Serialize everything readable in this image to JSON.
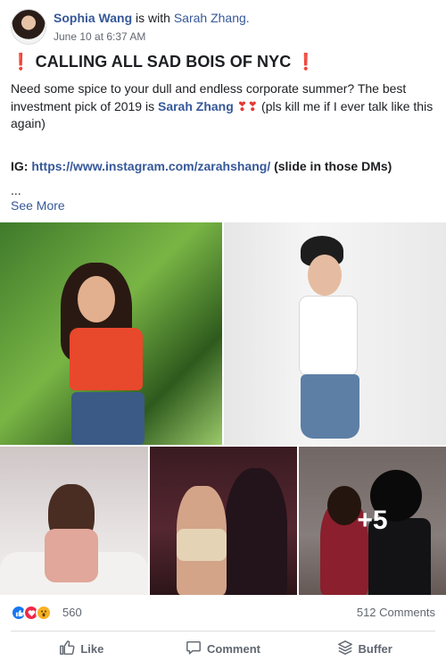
{
  "post": {
    "author": "Sophia Wang",
    "with_text": "is with",
    "tagged": "Sarah Zhang.",
    "timestamp": "June 10 at 6:37 AM",
    "title": "CALLING ALL SAD BOIS OF NYC",
    "title_emoji": "❗",
    "body_part1": "Need some spice to your dull and endless corporate summer? The best investment pick of 2019 is",
    "mention": "Sarah Zhang",
    "hearts": "❣❣",
    "body_part2": "(pls kill me if I ever talk like this again)",
    "ig_prefix": "IG:",
    "ig_url": "https://www.instagram.com/zarahshang/",
    "ig_suffix": "(slide in those DMs)",
    "ellipsis": "...",
    "see_more": "See More"
  },
  "photos": {
    "more_count": "+5"
  },
  "stats": {
    "reaction_count": "560",
    "comments": "512 Comments",
    "reaction_icons": [
      "like-icon",
      "love-icon",
      "wow-icon"
    ]
  },
  "actions": {
    "like": "Like",
    "comment": "Comment",
    "buffer": "Buffer"
  },
  "colors": {
    "link": "#365899",
    "muted": "#606770",
    "like": "#1877f2",
    "love": "#f02849",
    "wow": "#f7b125"
  }
}
